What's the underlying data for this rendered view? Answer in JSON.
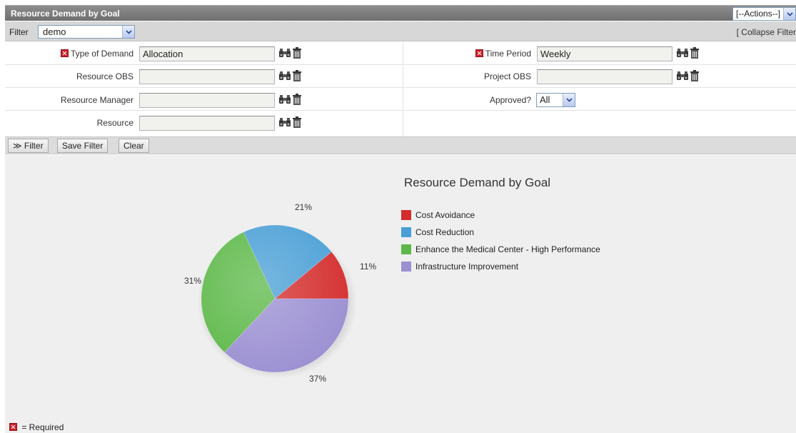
{
  "titlebar": {
    "title": "Resource Demand by Goal",
    "actions_value": "[--Actions--]"
  },
  "filterbar": {
    "label": "Filter",
    "selected": "demo",
    "collapse": "[ Collapse Filter"
  },
  "form": {
    "type_of_demand": {
      "label": "Type of Demand",
      "value": "Allocation"
    },
    "resource_obs": {
      "label": "Resource OBS",
      "value": ""
    },
    "resource_manager": {
      "label": "Resource Manager",
      "value": ""
    },
    "resource": {
      "label": "Resource",
      "value": ""
    },
    "time_period": {
      "label": "Time Period",
      "value": "Weekly"
    },
    "project_obs": {
      "label": "Project OBS",
      "value": ""
    },
    "approved": {
      "label": "Approved?",
      "value": "All"
    }
  },
  "buttons": {
    "filter": "≫ Filter",
    "save_filter": "Save Filter",
    "clear": "Clear"
  },
  "footer": {
    "required_note": "= Required"
  },
  "colors": {
    "red": "#d42d2d",
    "blue": "#4a9fd6",
    "green": "#5cb848",
    "purple": "#9b8fd2"
  },
  "chart_data": {
    "type": "pie",
    "title": "Resource Demand by Goal",
    "legend_position": "right",
    "categories": [
      "Cost Avoidance",
      "Cost Reduction",
      "Enhance the Medical Center - High Performance",
      "Infrastructure Improvement"
    ],
    "values": [
      11,
      21,
      31,
      37
    ],
    "labels": [
      "11%",
      "21%",
      "31%",
      "37%"
    ],
    "colors": [
      "#d42d2d",
      "#4a9fd6",
      "#5cb848",
      "#9b8fd2"
    ]
  }
}
